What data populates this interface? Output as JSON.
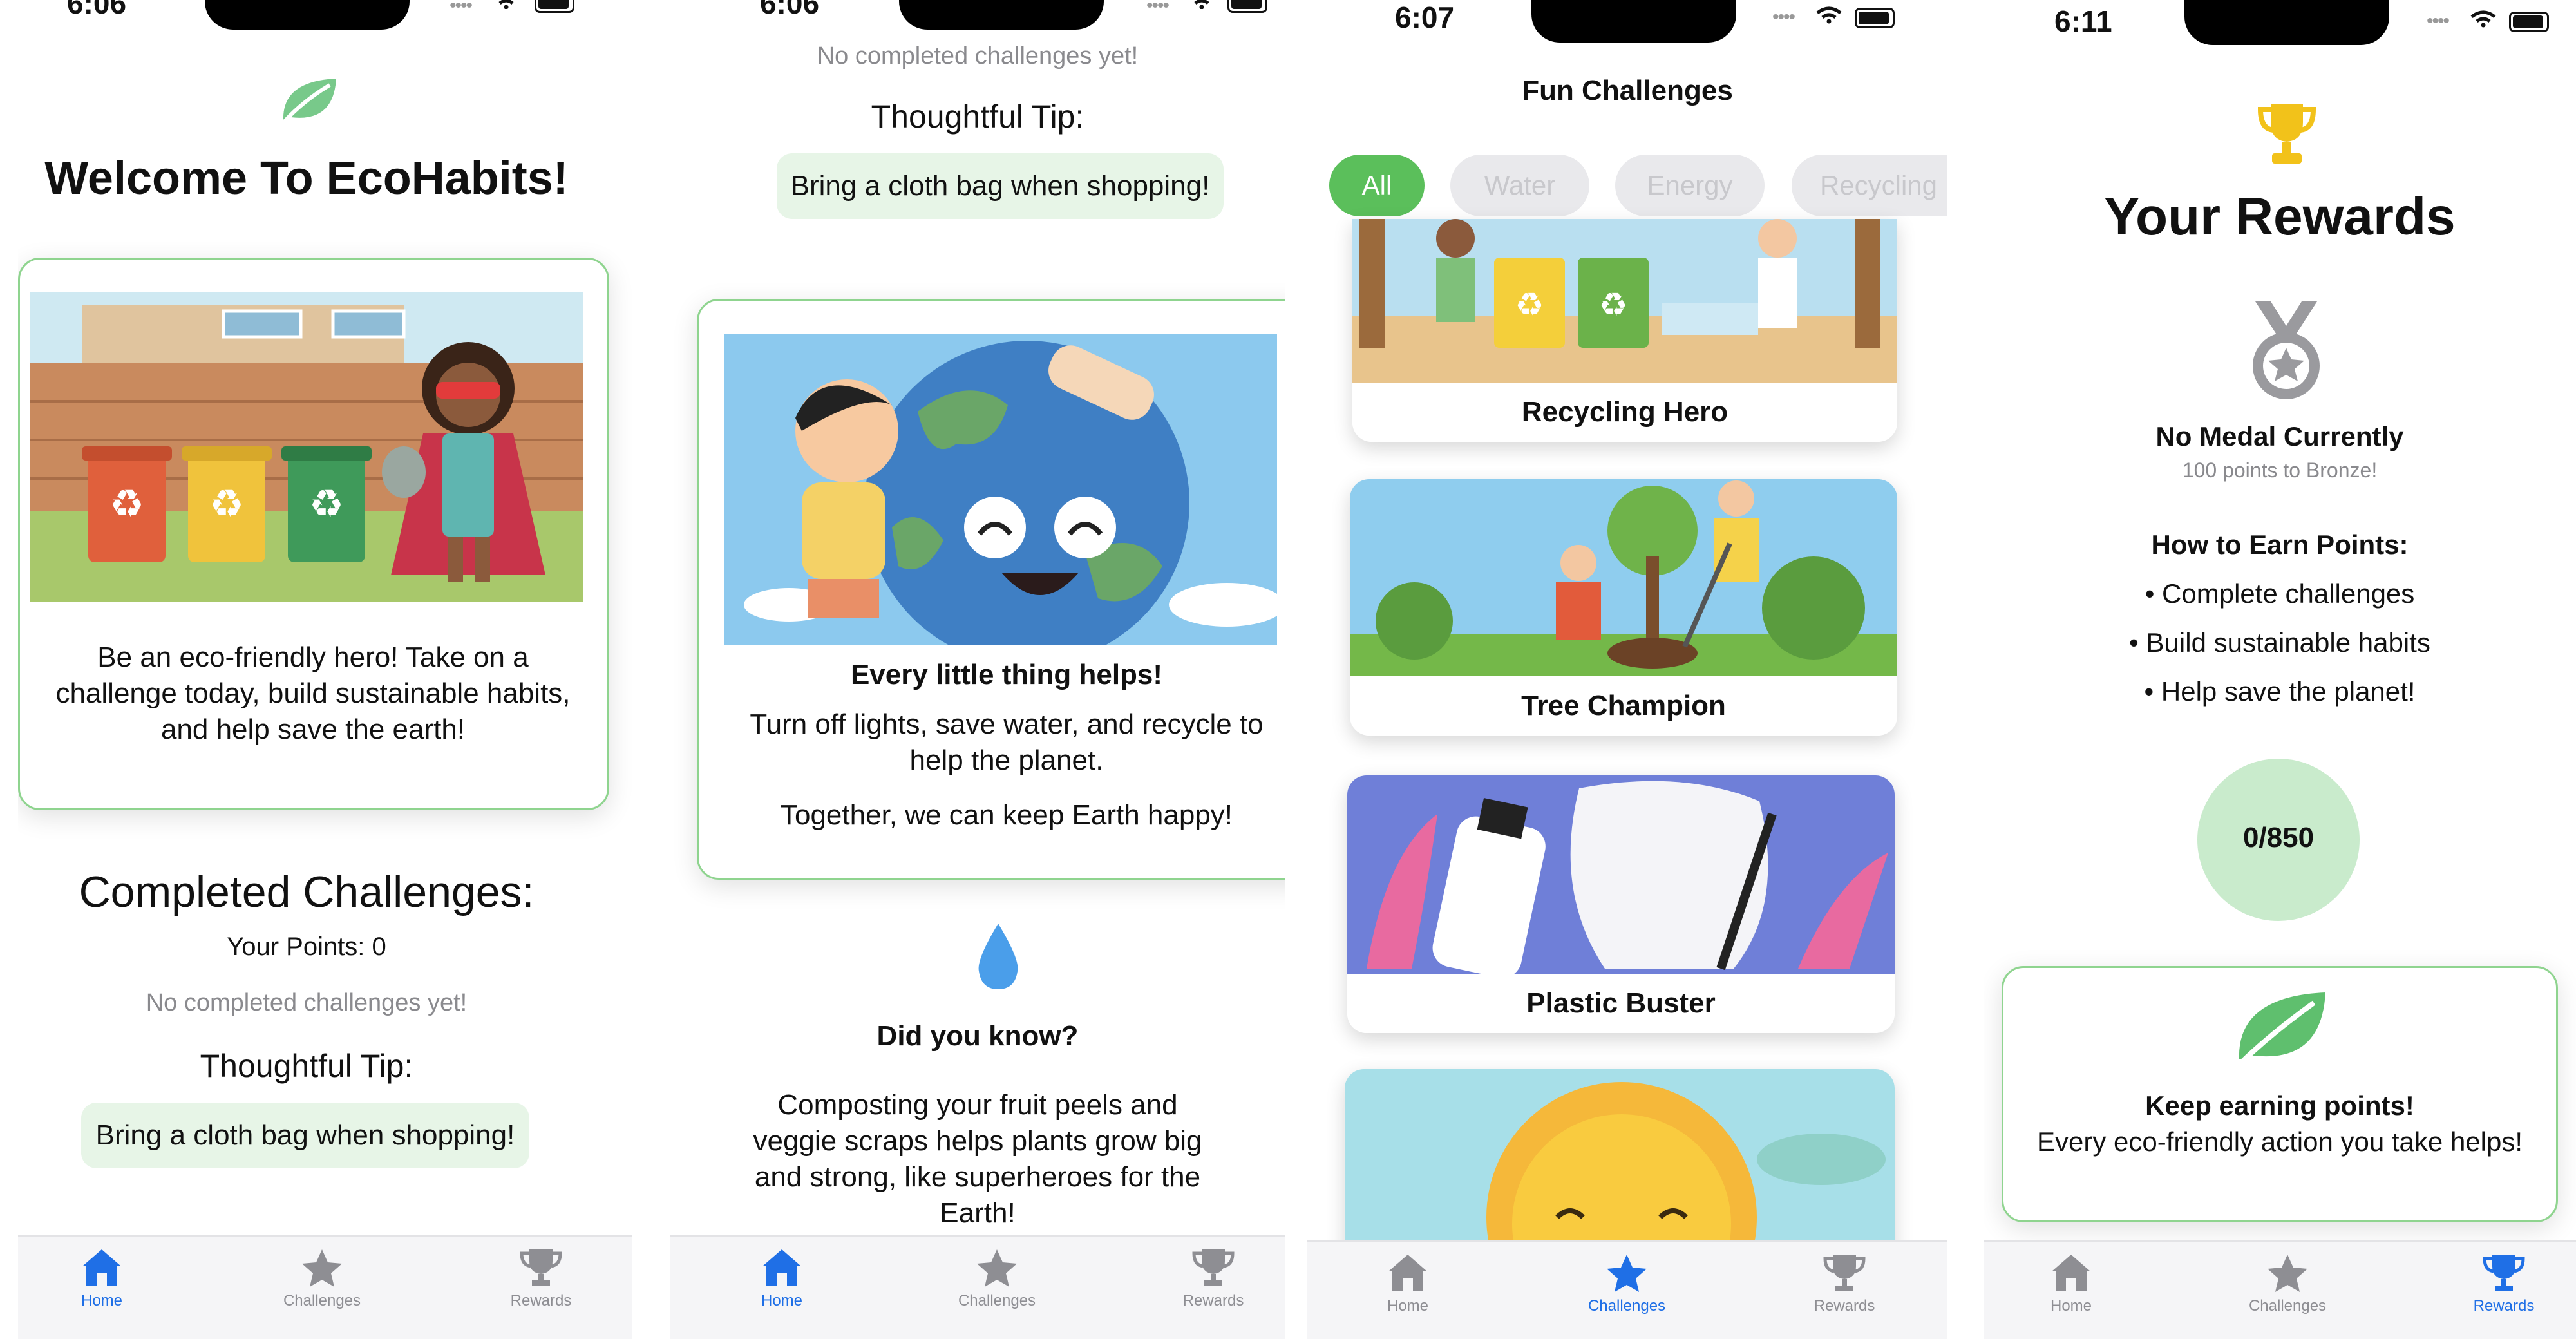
{
  "tabs": {
    "home": "Home",
    "challenges": "Challenges",
    "rewards": "Rewards"
  },
  "colors": {
    "accent": "#5bbf5b",
    "tab_active": "#1f6fe6",
    "tip_bg": "#e7f5e7",
    "border": "#8fd48f"
  },
  "screen1": {
    "time": "6:06",
    "title": "Welcome To EcoHabits!",
    "hero_text": "Be an eco-friendly hero! Take on a challenge today, build sustainable habits, and help save the earth!",
    "completed_heading": "Completed Challenges:",
    "points": "Your Points: 0",
    "empty": "No completed challenges yet!",
    "tip_heading": "Thoughtful Tip:",
    "tip": "Bring a cloth bag when shopping!",
    "active_tab": "home"
  },
  "screen2": {
    "time": "6:06",
    "empty": "No completed challenges yet!",
    "tip_heading": "Thoughtful Tip:",
    "tip": "Bring a cloth bag when shopping!",
    "card_heading": "Every little thing helps!",
    "card_text1": "Turn off lights, save water, and recycle to help the planet.",
    "card_text2": "Together, we can keep Earth happy!",
    "fact_heading": "Did you know?",
    "fact_text": "Composting your fruit peels and veggie scraps helps plants grow big and strong, like superheroes for the Earth!",
    "active_tab": "home"
  },
  "screen3": {
    "time": "6:07",
    "title": "Fun Challenges",
    "filters": [
      "All",
      "Water",
      "Energy",
      "Recycling"
    ],
    "selected_filter": "All",
    "challenges": [
      "Recycling Hero",
      "Tree Champion",
      "Plastic Buster"
    ],
    "active_tab": "challenges"
  },
  "screen4": {
    "time": "6:11",
    "title": "Your Rewards",
    "medal_status": "No Medal Currently",
    "medal_sub": "100 points to Bronze!",
    "earn_heading": "How to Earn Points:",
    "earn_items": [
      "• Complete challenges",
      "• Build sustainable habits",
      "• Help save the planet!"
    ],
    "progress": "0/850",
    "progress_fraction": 0,
    "keep_heading": "Keep earning points!",
    "keep_text": "Every eco-friendly action you take helps!",
    "active_tab": "rewards"
  }
}
